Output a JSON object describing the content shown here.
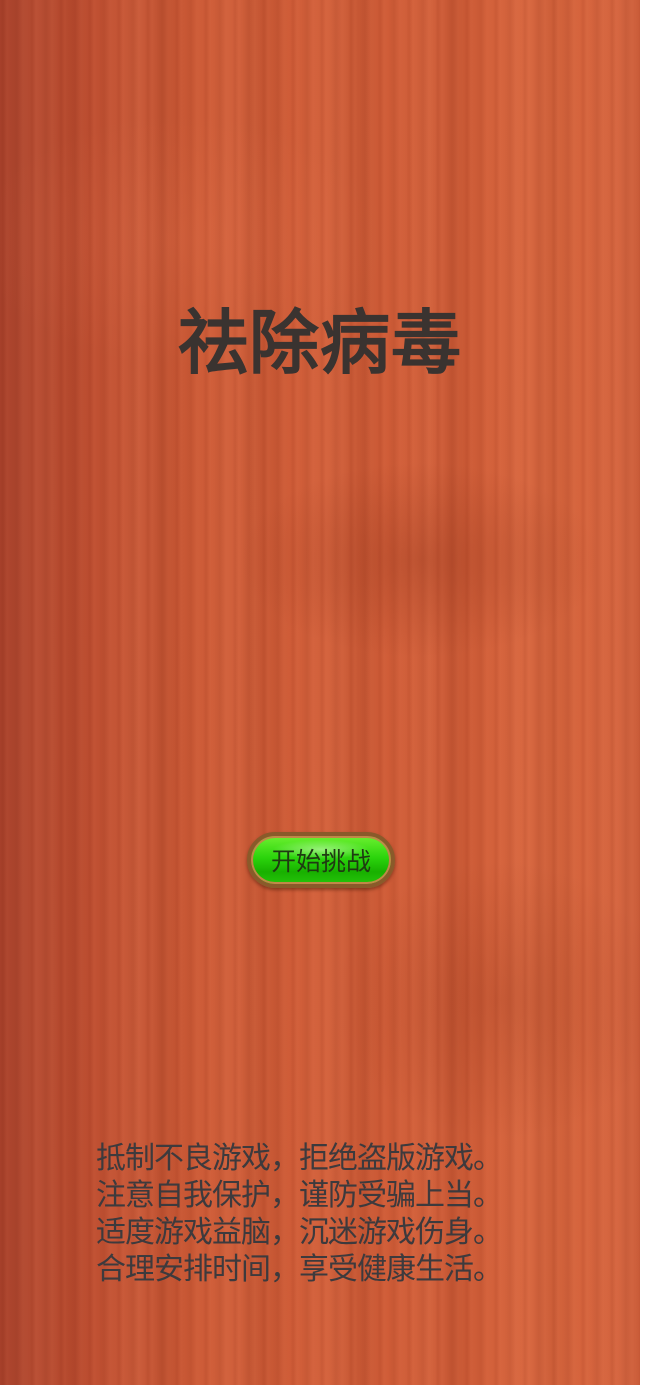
{
  "game": {
    "title": "祛除病毒",
    "start_button_label": "开始挑战",
    "notice_lines": [
      "抵制不良游戏，拒绝盗版游戏。",
      "注意自我保护，谨防受骗上当。",
      "适度游戏益脑，沉迷游戏伤身。",
      "合理安排时间，享受健康生活。"
    ]
  },
  "colors": {
    "background_wood": "#cc5a36",
    "title_text": "#3a3330",
    "button_green": "#2bd40c",
    "button_border": "#8a5a2a",
    "notice_text": "#3d3a3d"
  }
}
